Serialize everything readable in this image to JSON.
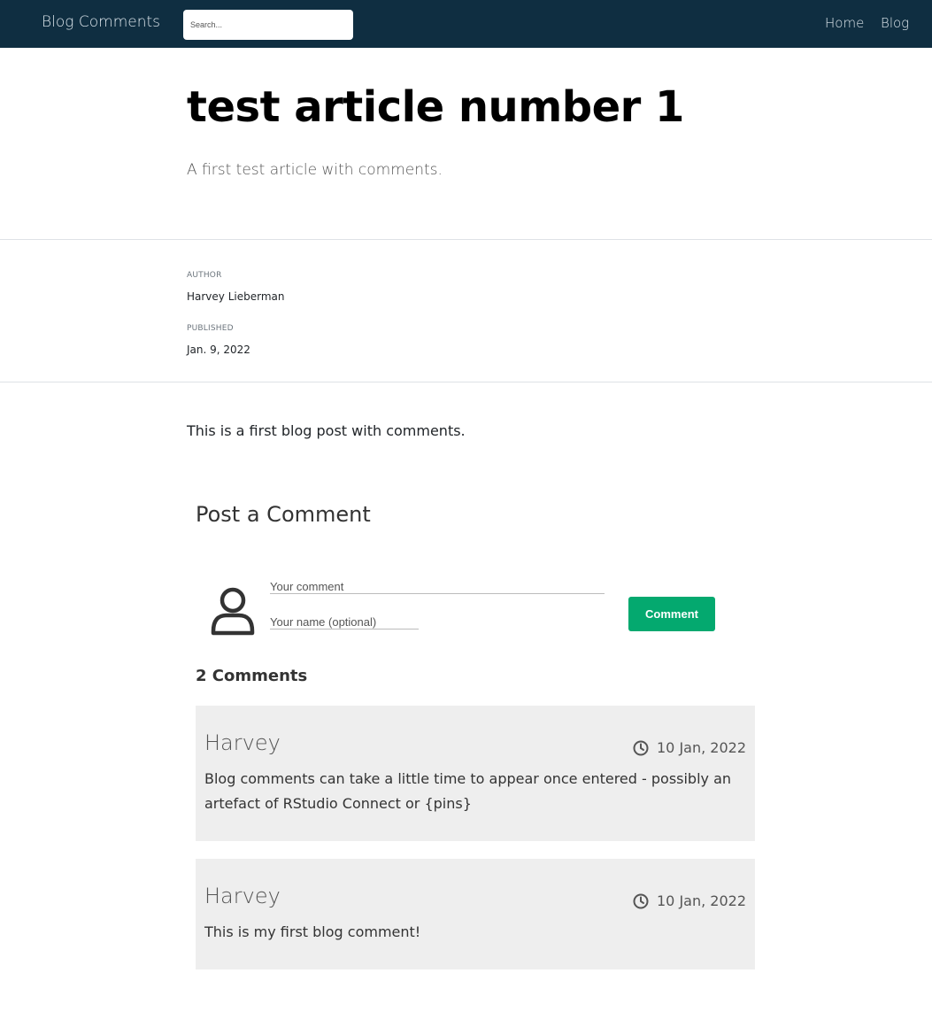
{
  "navbar": {
    "brand": "Blog Comments",
    "search_placeholder": "Search...",
    "links": [
      "Home",
      "Blog"
    ]
  },
  "article": {
    "title": "test article number 1",
    "subtitle": "A first test article with comments.",
    "author_label": "AUTHOR",
    "author": "Harvey Lieberman",
    "published_label": "PUBLISHED",
    "published": "Jan. 9, 2022",
    "body": "This is a first blog post with comments."
  },
  "comment_form": {
    "heading": "Post a Comment",
    "comment_placeholder": "Your comment",
    "name_placeholder": "Your name (optional)",
    "submit_label": "Comment"
  },
  "comments": {
    "count_label": "2 Comments",
    "items": [
      {
        "author": "Harvey",
        "date": "10 Jan, 2022",
        "text": "Blog comments can take a little time to appear once entered - possibly an artefact of RStudio Connect or {pins}"
      },
      {
        "author": "Harvey",
        "date": "10 Jan, 2022",
        "text": "This is my first blog comment!"
      }
    ]
  },
  "colors": {
    "navbar": "#0f2e41",
    "accent": "#04a96f",
    "card_bg": "#eeeeee"
  }
}
